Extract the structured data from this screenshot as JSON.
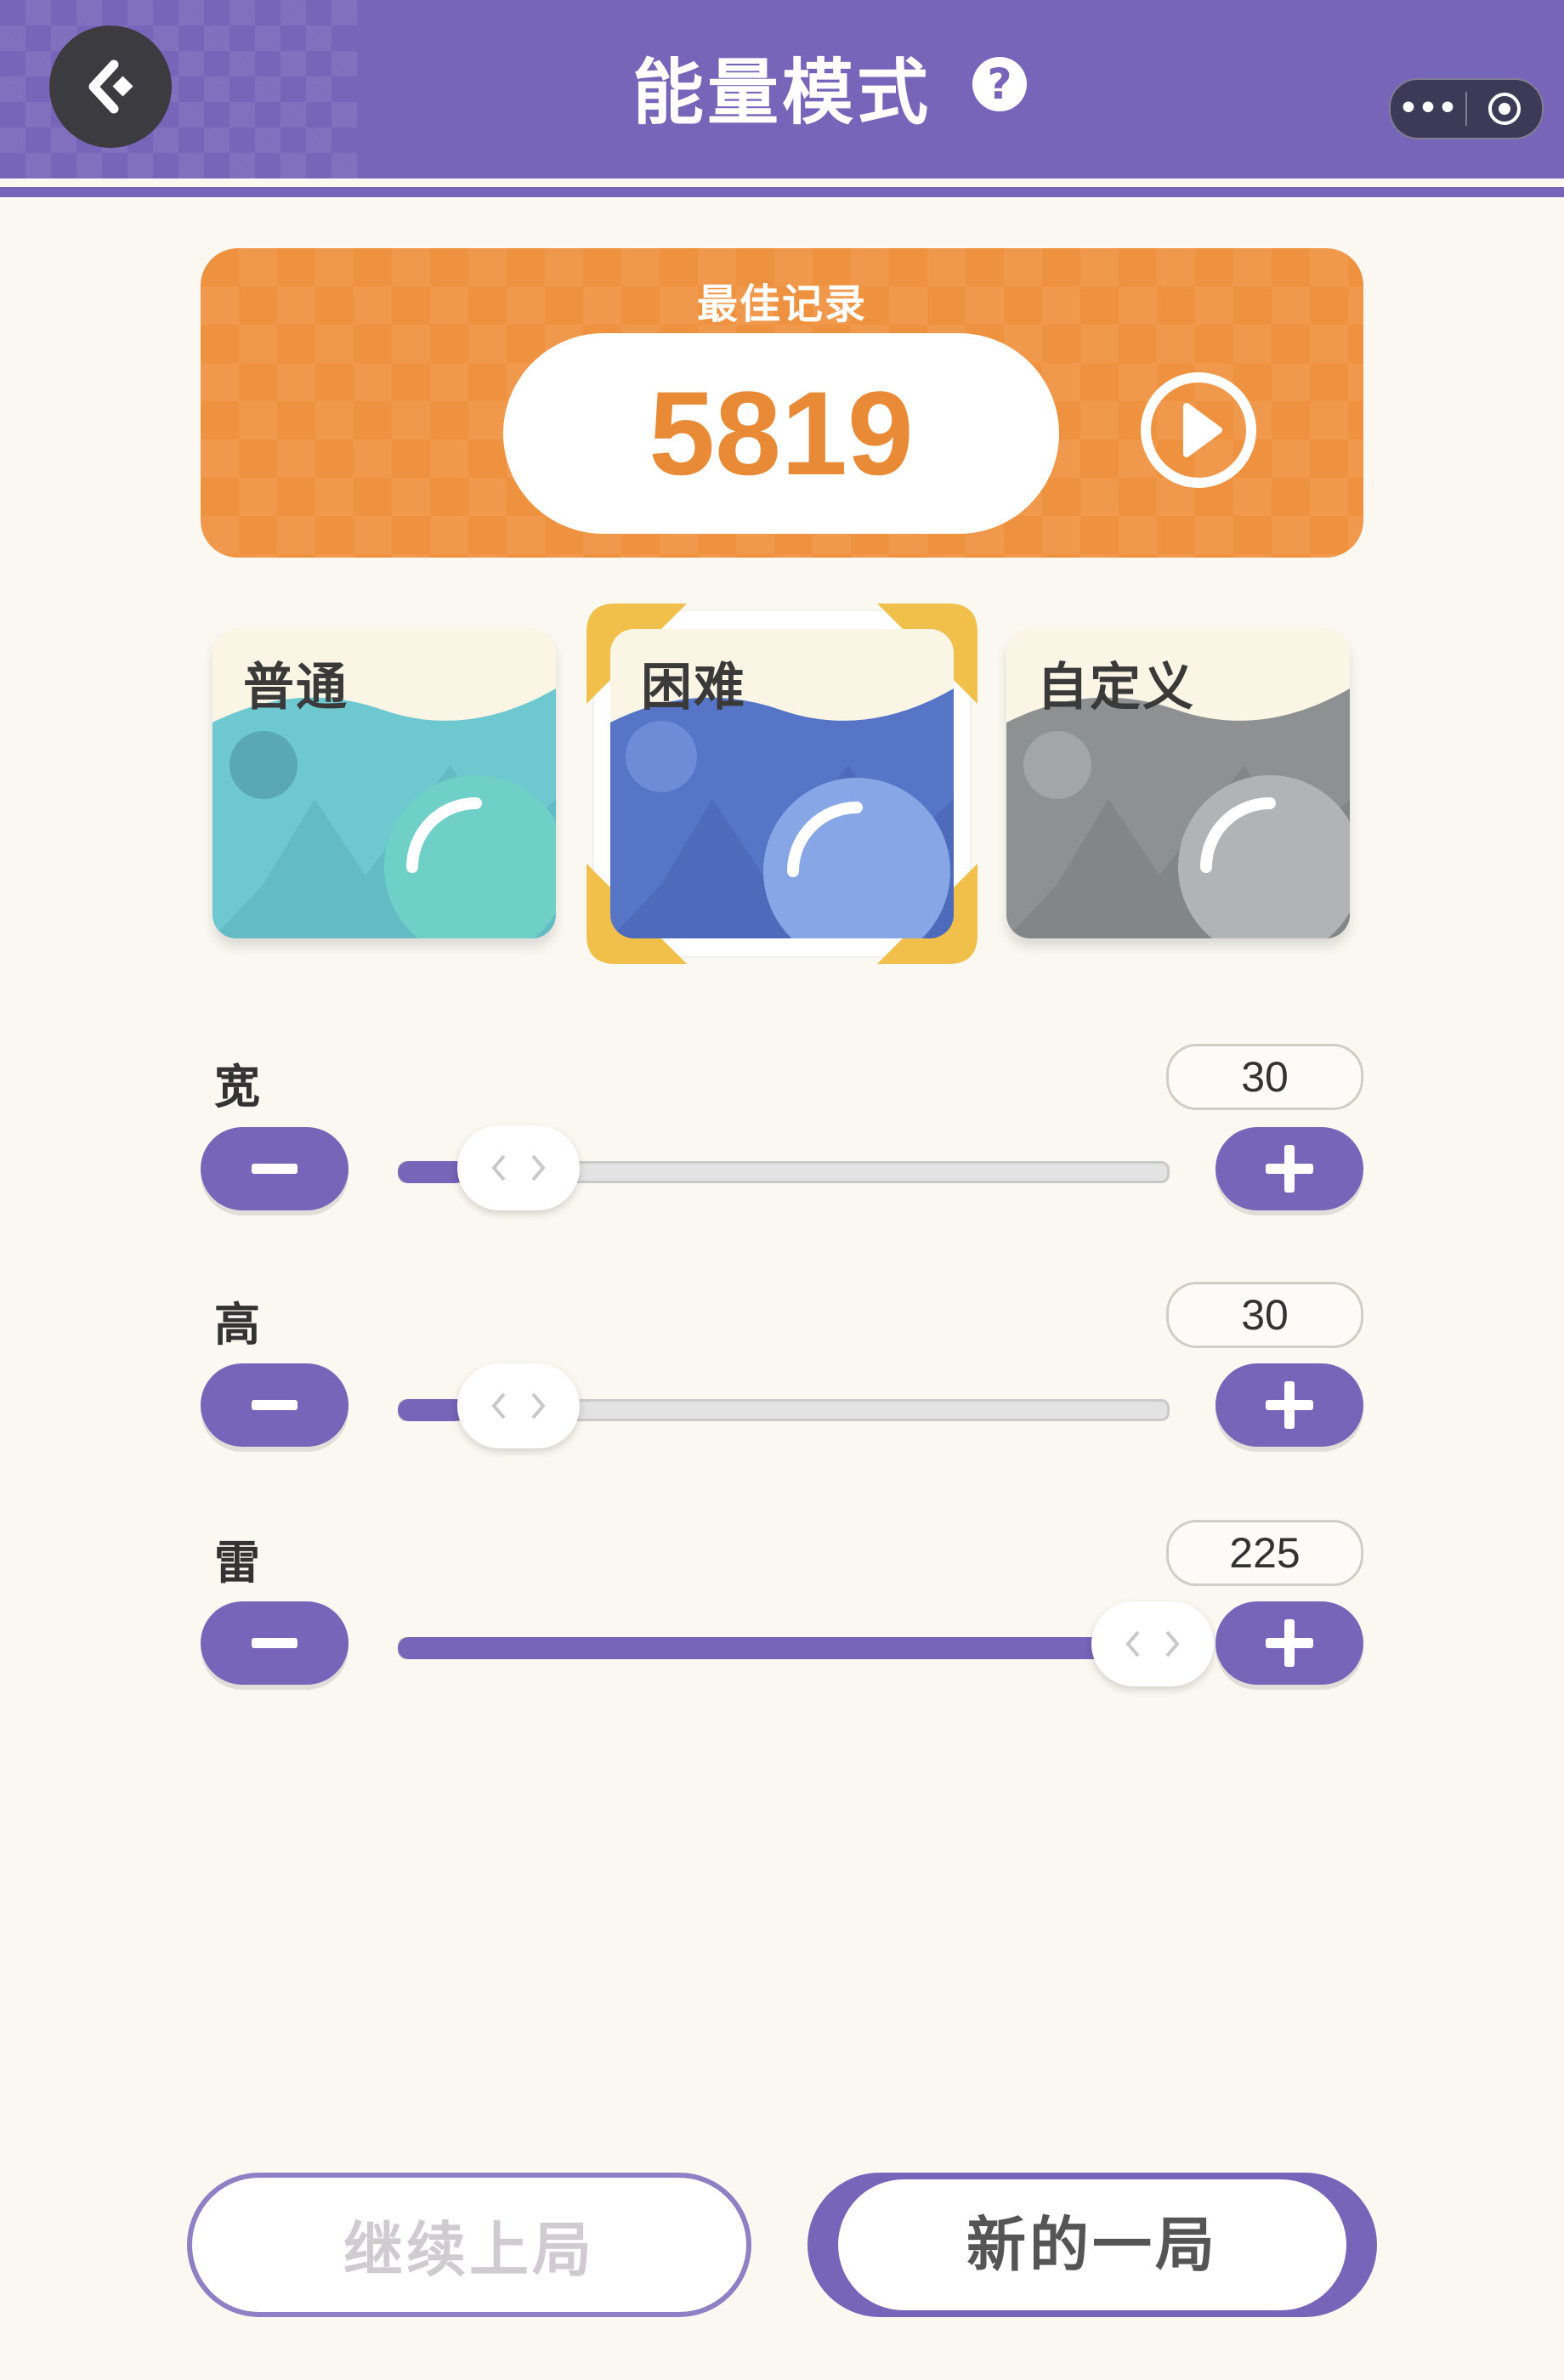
{
  "header": {
    "title": "能量模式",
    "help_icon": "help-circle-icon",
    "back_icon": "back-home-icon",
    "capsule": {
      "more_icon": "more-dots-icon",
      "close_icon": "target-circle-icon"
    },
    "color": "#7665b9"
  },
  "best_record": {
    "label": "最佳记录",
    "value": "5819",
    "play_icon": "play-circle-icon",
    "color": "#ef9240"
  },
  "modes": [
    {
      "label": "普通",
      "selected": false,
      "color": "#6ec8cf"
    },
    {
      "label": "困难",
      "selected": true,
      "color": "#5675c7"
    },
    {
      "label": "自定义",
      "selected": false,
      "color": "#9a9c9d"
    }
  ],
  "sliders": [
    {
      "label": "宽",
      "value": "30",
      "fill_fraction": 0.08
    },
    {
      "label": "高",
      "value": "30",
      "fill_fraction": 0.08
    },
    {
      "label": "雷",
      "value": "225",
      "fill_fraction": 0.99
    }
  ],
  "buttons": {
    "continue": "继续上局",
    "new_game": "新的一局"
  }
}
